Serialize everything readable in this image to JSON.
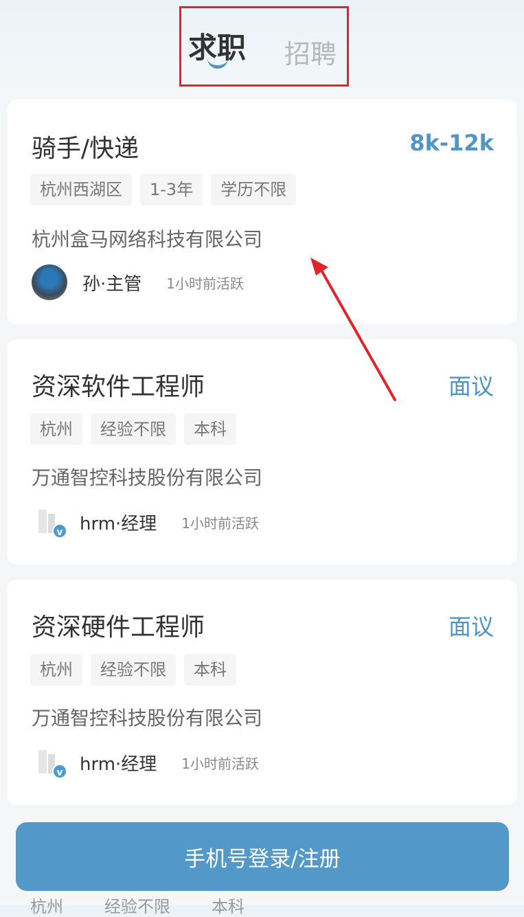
{
  "tabs": {
    "active": "求职",
    "inactive": "招聘"
  },
  "jobs": [
    {
      "title": "骑手/快递",
      "salary": "8k-12k",
      "tags": [
        "杭州西湖区",
        "1-3年",
        "学历不限"
      ],
      "company": "杭州盒马网络科技有限公司",
      "recruiter": "孙·主管",
      "active": "1小时前活跃"
    },
    {
      "title": "资深软件工程师",
      "salary": "面议",
      "tags": [
        "杭州",
        "经验不限",
        "本科"
      ],
      "company": "万通智控科技股份有限公司",
      "recruiter": "hrm·经理",
      "active": "1小时前活跃"
    },
    {
      "title": "资深硬件工程师",
      "salary": "面议",
      "tags": [
        "杭州",
        "经验不限",
        "本科"
      ],
      "company": "万通智控科技股份有限公司",
      "recruiter": "hrm·经理",
      "active": "1小时前活跃"
    }
  ],
  "partial_tags": [
    "杭州",
    "经验不限",
    "本科"
  ],
  "login_button": "手机号登录/注册",
  "verified_mark": "v",
  "colors": {
    "accent": "#4f95c6",
    "highlight_box": "#e0242a",
    "arrow": "#e0242a",
    "button": "#5298c8"
  }
}
